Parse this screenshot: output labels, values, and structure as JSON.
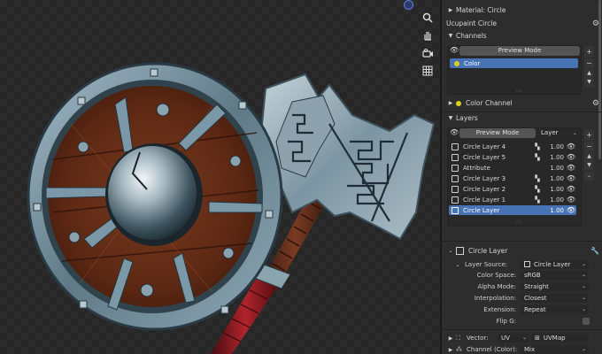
{
  "panel": {
    "material_row": "Material: Circle",
    "paint_row": "Ucupaint Circle",
    "channels_header": "Channels",
    "channels_preview_label": "Preview Mode",
    "channel_item": "Color",
    "color_channel": "Color Channel",
    "layers_header": "Layers",
    "layers_preview_label": "Preview Mode",
    "layers_mode_select": "Layer",
    "layers": [
      {
        "name": "Circle Layer 4",
        "opacity": "1.00"
      },
      {
        "name": "Circle Layer 5",
        "opacity": "1.00"
      },
      {
        "name": "Attribute",
        "opacity": "1.00"
      },
      {
        "name": "Circle Layer 3",
        "opacity": "1.00"
      },
      {
        "name": "Circle Layer 2",
        "opacity": "1.00"
      },
      {
        "name": "Circle Layer 1",
        "opacity": "1.00"
      },
      {
        "name": "Circle Layer",
        "opacity": "1.00"
      }
    ],
    "selected_layer_title": "Circle Layer",
    "layer_source_label": "Layer Source:",
    "layer_source_value": "Circle Layer",
    "props": [
      {
        "label": "Color Space:",
        "value": "sRGB"
      },
      {
        "label": "Alpha Mode:",
        "value": "Straight"
      },
      {
        "label": "Interpolation:",
        "value": "Closest"
      },
      {
        "label": "Extension:",
        "value": "Repeat"
      }
    ],
    "flip_label": "Flip G:",
    "vector_label": "Vector:",
    "vector_type": "UV",
    "vector_map": "UVMap",
    "channel_color_label": "Channel (Color):",
    "channel_color_value": "Mix"
  },
  "colors": {
    "selection": "#4772b3",
    "channel_dot": "#d8d020",
    "wood": "#6b2d17",
    "metal_rim": "#6e8a99"
  },
  "icons": [
    "zoom-icon",
    "hand-icon",
    "camera-icon",
    "grid-icon",
    "eye-icon",
    "gear-icon",
    "plus-icon",
    "minus-icon",
    "wrench-icon"
  ]
}
